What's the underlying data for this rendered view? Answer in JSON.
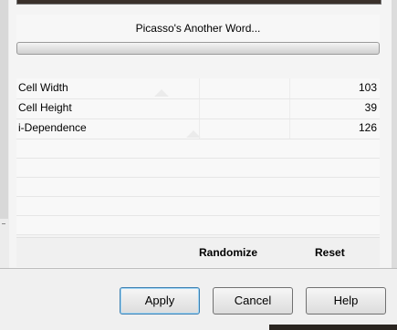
{
  "filter": {
    "title": "Picasso's Another Word..."
  },
  "parameters": [
    {
      "label": "Cell Width",
      "value": "103"
    },
    {
      "label": "Cell Height",
      "value": "39"
    },
    {
      "label": "i-Dependence",
      "value": "126"
    }
  ],
  "links": {
    "randomize": "Randomize",
    "reset": "Reset"
  },
  "buttons": {
    "apply": "Apply",
    "cancel": "Cancel",
    "help": "Help"
  }
}
